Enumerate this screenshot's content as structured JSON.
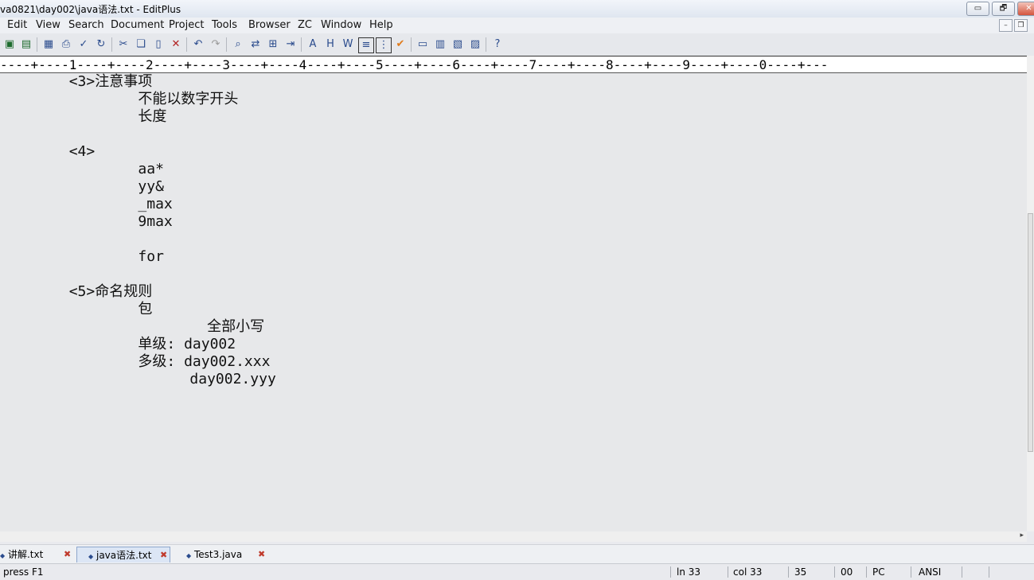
{
  "window": {
    "title": "va0821\\day002\\java语法.txt - EditPlus",
    "controls": [
      "▭",
      "🗗",
      "✕"
    ]
  },
  "menu": [
    "Edit",
    "View",
    "Search",
    "Document",
    "Project",
    "Tools",
    "Browser",
    "ZC",
    "Window",
    "Help"
  ],
  "toolbar": {
    "icons": [
      "save-icon",
      "save-all-icon",
      "print-preview-icon",
      "print-icon",
      "spell-check-icon",
      "refresh-icon",
      "cut-icon",
      "copy-icon",
      "paste-icon",
      "delete-icon",
      "undo-icon",
      "redo-icon",
      "find-icon",
      "replace-icon",
      "find-in-files-icon",
      "goto-line-icon",
      "font-icon",
      "hex-icon",
      "word-wrap-icon",
      "line-icon",
      "column-icon",
      "check-icon",
      "browser-icon",
      "output-icon",
      "clip-icon",
      "cliptext-icon",
      "help-icon"
    ]
  },
  "ruler": {
    "text": "----+----1----+----2----+----3----+----4----+----5----+----6----+----7----+----8----+----9----+----0----+---"
  },
  "editor": {
    "lines": [
      "        <3>注意事项",
      "                不能以数字开头",
      "                长度",
      "",
      "        <4>",
      "                aa*",
      "                yy&",
      "                _max",
      "                9max",
      "",
      "                for",
      "",
      "        <5>命名规则",
      "                包",
      "                        全部小写",
      "                单级: day002",
      "                多级: day002.xxx",
      "                      day002.yyy"
    ]
  },
  "tabs": [
    {
      "label": "讲解.txt",
      "active": false
    },
    {
      "label": "java语法.txt",
      "active": true
    },
    {
      "label": "Test3.java",
      "active": false
    }
  ],
  "status": {
    "hint": "press F1",
    "line": "ln 33",
    "col": "col 33",
    "num1": "35",
    "num2": "00",
    "mode": "PC",
    "encoding": "ANSI"
  }
}
